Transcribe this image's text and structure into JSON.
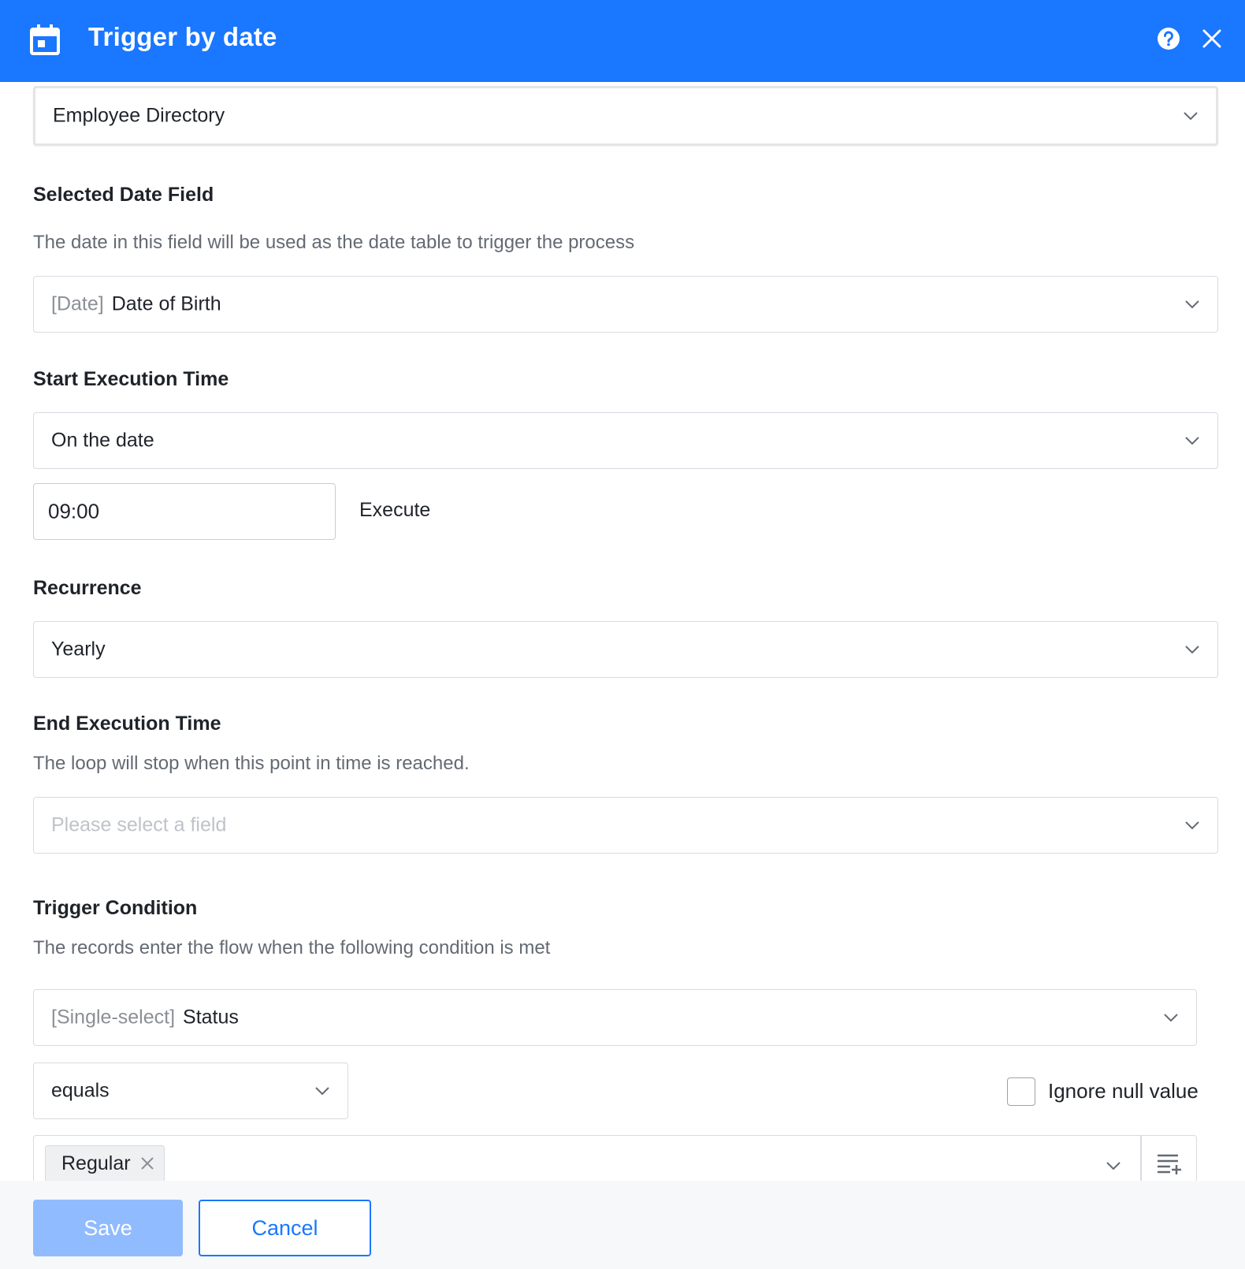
{
  "header": {
    "title": "Trigger by date",
    "icon": "calendar-icon",
    "bg_color": "#1a77ff"
  },
  "table_select": {
    "value": "Employee Directory"
  },
  "date_field": {
    "title": "Selected Date Field",
    "description": "The date in this field will be used as the date table to trigger the process",
    "prefix": "[Date]",
    "value": "Date of Birth"
  },
  "start_time": {
    "title": "Start Execution Time",
    "value": "On the date",
    "time": "09:00",
    "time_suffix": "Execute"
  },
  "recurrence": {
    "title": "Recurrence",
    "value": "Yearly"
  },
  "end_time": {
    "title": "End Execution Time",
    "description": "The loop will stop when this point in time is reached.",
    "placeholder": "Please select a field"
  },
  "trigger_condition": {
    "title": "Trigger Condition",
    "description": "The records enter the flow when the following condition is met",
    "field_prefix": "[Single-select]",
    "field_value": "Status",
    "operator": "equals",
    "ignore_null_label": "Ignore null value",
    "ignore_null_checked": false,
    "selected_tags": [
      "Regular"
    ]
  },
  "footer": {
    "save_label": "Save",
    "cancel_label": "Cancel"
  }
}
